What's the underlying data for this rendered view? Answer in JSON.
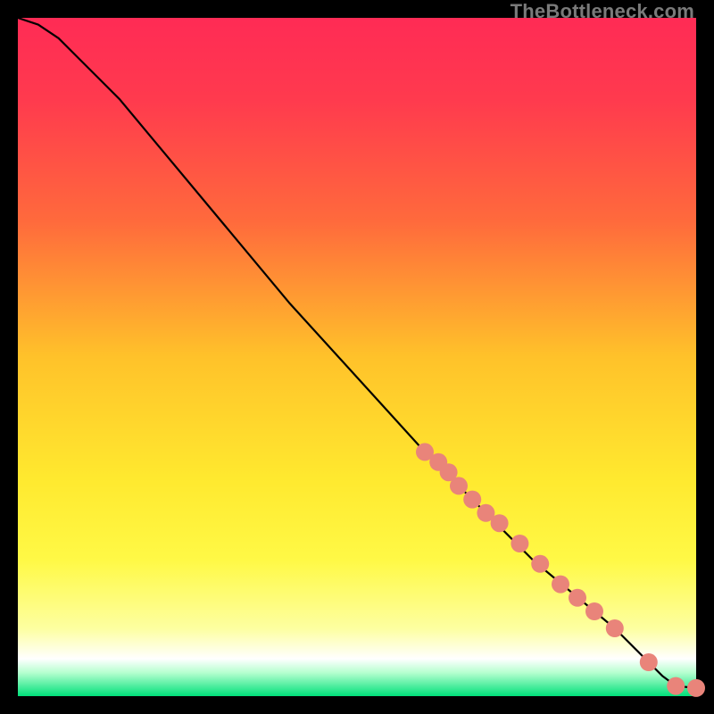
{
  "watermark": "TheBottleneck.com",
  "gradient_stops": [
    {
      "offset": 0,
      "color": "#ff2b55"
    },
    {
      "offset": 0.12,
      "color": "#ff3a4e"
    },
    {
      "offset": 0.3,
      "color": "#ff6a3c"
    },
    {
      "offset": 0.5,
      "color": "#ffc22a"
    },
    {
      "offset": 0.68,
      "color": "#ffe92f"
    },
    {
      "offset": 0.8,
      "color": "#fff946"
    },
    {
      "offset": 0.9,
      "color": "#fdffa0"
    },
    {
      "offset": 0.945,
      "color": "#ffffff"
    },
    {
      "offset": 0.965,
      "color": "#b7ffd0"
    },
    {
      "offset": 1.0,
      "color": "#00e07a"
    }
  ],
  "chart_data": {
    "type": "line",
    "title": "",
    "xlabel": "",
    "ylabel": "",
    "xlim": [
      0,
      100
    ],
    "ylim": [
      0,
      100
    ],
    "series": [
      {
        "name": "curve",
        "x": [
          0,
          3,
          6,
          9,
          12,
          15,
          20,
          30,
          40,
          50,
          60,
          65,
          70,
          73,
          76,
          79,
          82,
          85,
          88,
          91,
          93,
          95,
          97,
          100
        ],
        "y": [
          100,
          99,
          97,
          94,
          91,
          88,
          82,
          70,
          58,
          47,
          36,
          31,
          26,
          23,
          20,
          17.5,
          15,
          12.5,
          10,
          7,
          5,
          3,
          1.5,
          1.2
        ]
      }
    ],
    "markers": {
      "name": "highlight-points",
      "color": "#e9847a",
      "radius": 10,
      "x": [
        60,
        62,
        63.5,
        65,
        67,
        69,
        71,
        74,
        77,
        80,
        82.5,
        85,
        88,
        93,
        97,
        100
      ],
      "y": [
        36,
        34.5,
        33,
        31,
        29,
        27,
        25.5,
        22.5,
        19.5,
        16.5,
        14.5,
        12.5,
        10,
        5,
        1.5,
        1.2
      ]
    }
  }
}
